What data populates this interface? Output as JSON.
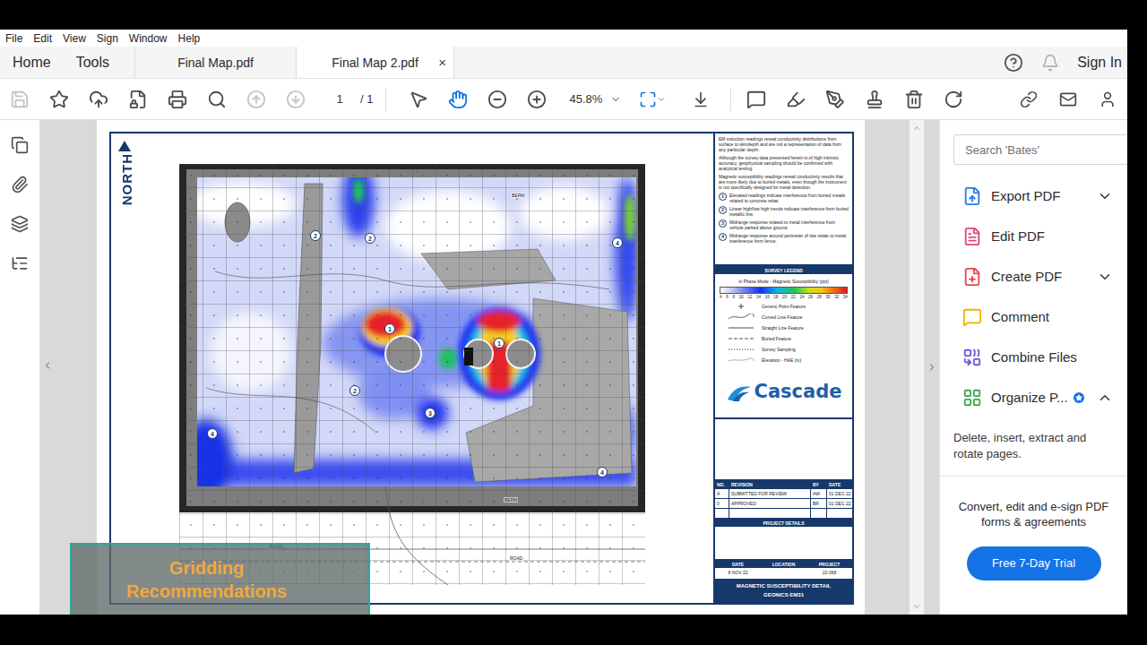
{
  "menu": [
    "File",
    "Edit",
    "View",
    "Sign",
    "Window",
    "Help"
  ],
  "nav": [
    "Home",
    "Tools"
  ],
  "tabs": [
    {
      "label": "Final Map.pdf",
      "selected": false,
      "closable": false
    },
    {
      "label": "Final Map 2.pdf",
      "selected": true,
      "closable": true
    }
  ],
  "close_glyph": "×",
  "sign_in": "Sign In",
  "toolbar": {
    "file_tools": [
      {
        "disabled": true
      },
      {
        "disabled": false
      },
      {
        "disabled": false
      },
      {
        "disabled": false
      },
      {
        "disabled": false
      },
      {
        "disabled": false
      }
    ],
    "page_nav": [
      {
        "disabled": true
      },
      {
        "disabled": true
      }
    ],
    "page": "1",
    "page_total": "/ 1",
    "view_tools": [
      {
        "selected": false
      },
      {
        "selected": true
      },
      {
        "selected": false
      },
      {
        "selected": false
      }
    ],
    "zoom": "45.8%",
    "layout_tools": [
      {
        "selected": true
      },
      {
        "selected": false
      }
    ]
  },
  "right_panel": {
    "search_placeholder": "Search 'Bates'",
    "tools": [
      {
        "label": "Export PDF",
        "color": "#2d7be5",
        "expandable": true,
        "expanded": false,
        "badge": false
      },
      {
        "label": "Edit PDF",
        "color": "#e0457b",
        "expandable": false,
        "expanded": false,
        "badge": false
      },
      {
        "label": "Create PDF",
        "color": "#e34850",
        "expandable": true,
        "expanded": false,
        "badge": false
      },
      {
        "label": "Comment",
        "color": "#f0b400",
        "expandable": false,
        "expanded": false,
        "badge": false
      },
      {
        "label": "Combine Files",
        "color": "#6b5bd6",
        "expandable": false,
        "expanded": false,
        "badge": false
      },
      {
        "label": "Organize P...",
        "color": "#3da74e",
        "expandable": true,
        "expanded": true,
        "badge": true
      }
    ],
    "description": "Delete, insert, extract and rotate pages.",
    "promo": "Convert, edit and e-sign PDF forms & agreements",
    "button": "Free 7-Day Trial"
  },
  "document": {
    "north": "NORTH",
    "map_labels": [
      "BERM",
      "BERM",
      "ROAD",
      "ROAD"
    ],
    "markers": [
      "2",
      "2",
      "4",
      "1",
      "1",
      "2",
      "3",
      "4",
      "4"
    ],
    "notes": [
      "EM induction readings reveal conductivity distributions from surface to skindepth and are not a representation of data from any particular depth.",
      "Although the survey data presented herein is of high intrinsic accuracy, geophysical sampling should be confirmed with analytical testing.",
      "Magnetic susceptibility readings reveal conductivity results that are more likely due to buried metals, even though the instrument is not specifically designed for metal detection."
    ],
    "findings": [
      {
        "number": "1",
        "text": "Elevated readings indicate interference from buried metals related to concrete rebar."
      },
      {
        "number": "2",
        "text": "Linear high/low high trends indicate interference from buried metallic line."
      },
      {
        "number": "3",
        "text": "Midrange response related to metal interference from vehicle parked above ground."
      },
      {
        "number": "4",
        "text": "Midrange response around perimeter of site relate to metal interference from fence."
      }
    ],
    "legend_title": "SURVEY LEGEND",
    "scale_title": "In Phase Mode - Magnetic Susceptibility (ppt)",
    "scale_ticks": [
      "4",
      "6",
      "8",
      "10",
      "12",
      "14",
      "16",
      "18",
      "20",
      "22",
      "24",
      "26",
      "28",
      "30",
      "32",
      "34"
    ],
    "legend_items": [
      {
        "label": "Generic Point Feature",
        "kind": "point"
      },
      {
        "label": "Curved Line Feature",
        "kind": "curve"
      },
      {
        "label": "Straight Line Feature",
        "kind": "line"
      },
      {
        "label": "Buried Feature",
        "kind": "dashed"
      },
      {
        "label": "Survey Sampling",
        "kind": "dotted"
      },
      {
        "label": "Elevation - HAE (m)",
        "kind": "contour"
      }
    ],
    "logo": "Cascade",
    "revision_columns": [
      "NO.",
      "REVISION",
      "BY",
      "DATE"
    ],
    "revisions": [
      [
        "A",
        "SUBMITTED FOR REVIEW",
        "AW",
        "01 DEC 22"
      ],
      [
        "0",
        "APPROVED",
        "BR",
        "01 DEC 22"
      ]
    ],
    "project_details_title": "PROJECT DETAILS",
    "info": [
      {
        "label": "DATE",
        "value": "8 NOV 22"
      },
      {
        "label": "LOCATION"
      },
      {
        "label": "PROJECT",
        "value": "22-068"
      }
    ],
    "title_lines": [
      "MAGNETIC SUSCEPTIBILITY DETAIL",
      "GEONICS EM31"
    ]
  },
  "caption": "Gridding Recommendations"
}
